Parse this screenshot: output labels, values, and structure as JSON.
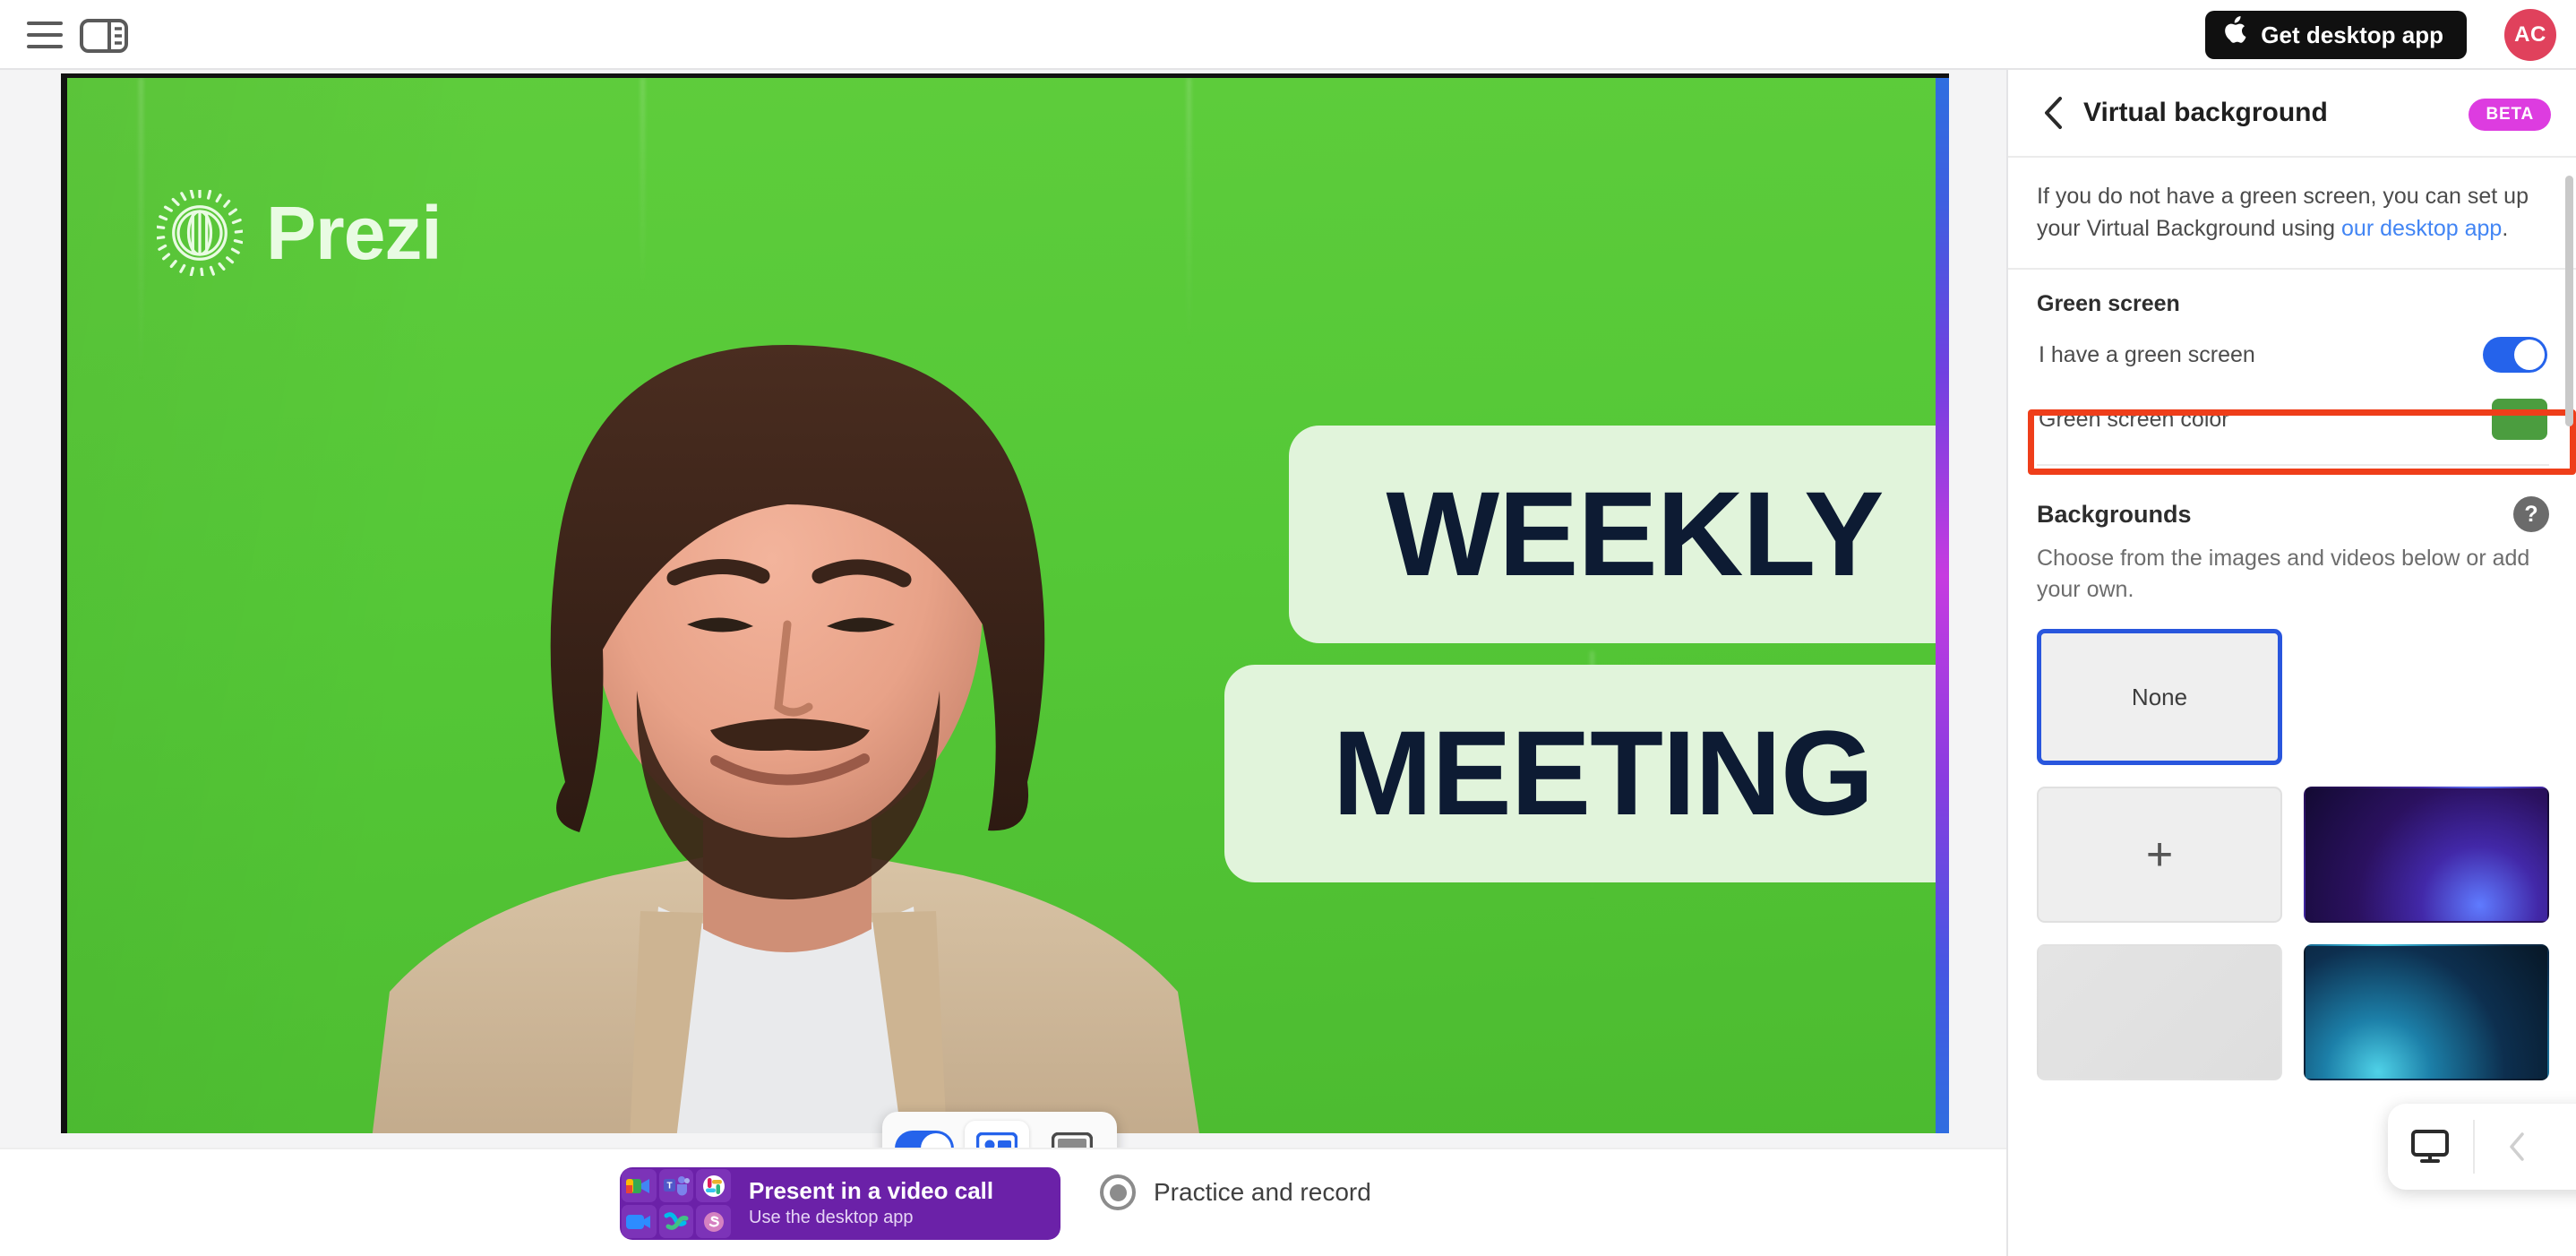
{
  "topbar": {
    "menu_icon": "hamburger-menu-icon",
    "panel_icon": "panel-layout-icon",
    "desktop_app_button": "Get desktop app",
    "apple_glyph": "",
    "avatar_initials": "AC"
  },
  "slide": {
    "brand": "Prezi",
    "title_line1": "WEEKLY",
    "title_line2": "MEETING",
    "green_screen_color": "#55c837",
    "text_block_color": "#e1f4db",
    "text_color": "#0d1b33",
    "accent_strip": "blue-purple-magenta-gradient"
  },
  "video_controls": {
    "camera_toggle_state": "on",
    "modes": [
      {
        "name": "presenter-with-content",
        "label": "Presenter and content",
        "active": true
      },
      {
        "name": "content-only",
        "label": "Content only",
        "active": false
      }
    ]
  },
  "bottombar": {
    "present_card": {
      "title": "Present in a video call",
      "subtitle": "Use the desktop app",
      "apps": [
        "google-meet",
        "microsoft-teams",
        "slack",
        "zoom",
        "webex",
        "skype"
      ],
      "background_color": "#6b21a8"
    },
    "practice": {
      "label": "Practice and record",
      "icon": "record-icon"
    }
  },
  "rightpanel": {
    "back_icon": "back-chevron-icon",
    "title": "Virtual background",
    "badge": "BETA",
    "badge_color": "#dd3ce0",
    "info": {
      "text_before": "If you do not have a green screen, you can set up your Virtual Background using ",
      "link": "our desktop app",
      "text_after": "."
    },
    "green_screen": {
      "section_label": "Green screen",
      "toggle_label": "I have a green screen",
      "toggle_state": "on",
      "color_label": "Green screen color",
      "color_value": "#4b9d3f",
      "highlight_color": "#ef3e1a"
    },
    "backgrounds": {
      "title": "Backgrounds",
      "help_icon": "help-question-icon",
      "description": "Choose from the images and videos below or add your own.",
      "items": [
        {
          "name": "none-thumbnail",
          "label": "None",
          "selected": true,
          "style": "plain"
        },
        {
          "name": "empty-slot",
          "label": "",
          "selected": false,
          "style": "invisible"
        },
        {
          "name": "add-background-button",
          "label": "+",
          "selected": false,
          "style": "add"
        },
        {
          "name": "purple-nebula-thumbnail",
          "label": "",
          "selected": false,
          "style": "purple"
        },
        {
          "name": "gray-gradient-thumbnail",
          "label": "",
          "selected": false,
          "style": "gray"
        },
        {
          "name": "teal-blue-thumbnail",
          "label": "",
          "selected": false,
          "style": "teal"
        }
      ]
    },
    "mini_toolbar": {
      "monitor_icon": "monitor-screen-icon",
      "prev_icon": "chevron-left-icon",
      "next_icon": "chevron-right-icon"
    }
  }
}
